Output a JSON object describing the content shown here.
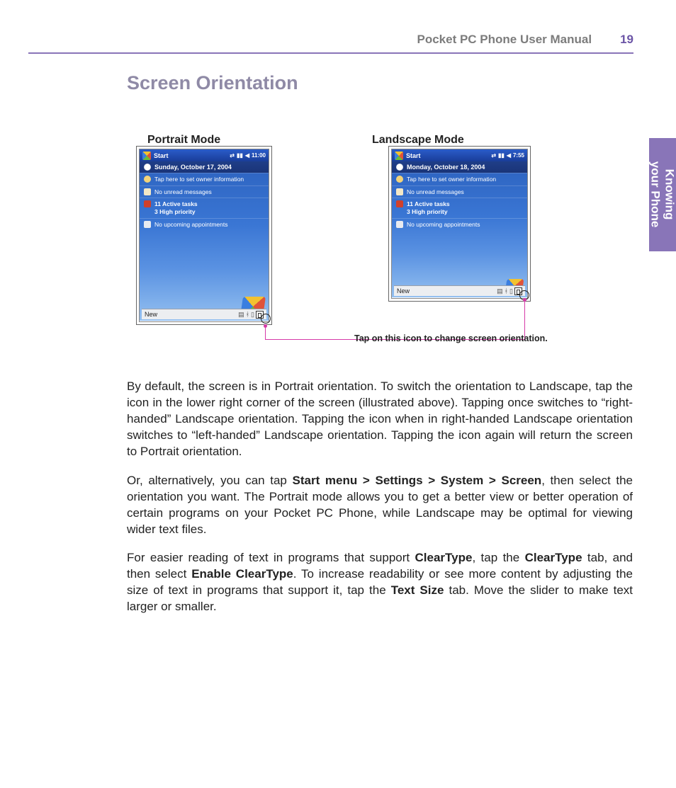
{
  "header": {
    "manual_title": "Pocket PC Phone User Manual",
    "page_number": "19"
  },
  "chapter_tab": {
    "line1": "Knowing",
    "line2": "your  Phone"
  },
  "section_title": "Screen Orientation",
  "modes": {
    "portrait_label": "Portrait Mode",
    "landscape_label": "Landscape Mode"
  },
  "portrait_screen": {
    "start": "Start",
    "clock": "11:00",
    "date": "Sunday, October 17, 2004",
    "items": [
      "Tap here to set owner information",
      "No unread messages",
      "11 Active tasks\n3 High priority",
      "No upcoming appointments"
    ],
    "newbar": "New"
  },
  "landscape_screen": {
    "start": "Start",
    "clock": "7:55",
    "date": "Monday, October 18, 2004",
    "items": [
      "Tap here to set owner information",
      "No unread messages",
      "11 Active tasks\n3 High priority",
      "No upcoming appointments"
    ],
    "newbar": "New"
  },
  "callout": "Tap on this icon to change screen orientation.",
  "paragraphs": {
    "p1a": "By default, the screen is in Portrait orientation.  To switch the orientation to Landscape, tap the icon in the lower right corner of the screen (illustrated above).  Tapping once switches to “right-handed” Landscape orientation.  Tapping the icon when in right-handed Landscape orientation switches to “left-handed” Landscape orientation.  Tapping the icon again will return the screen to Portrait orientation.",
    "p2_pre": "Or, alternatively, you can tap ",
    "p2_bold1": "Start menu > Settings > System > Screen",
    "p2_post": ", then select the orientation you want.  The Portrait mode allows you to get a better view or better opera­tion of certain programs on your Pocket PC Phone, while Landscape may be optimal for viewing wider text files.",
    "p3_pre": "For easier reading of text in programs that support ",
    "p3_b1": "ClearType",
    "p3_mid1": ", tap the ",
    "p3_b2": "ClearType",
    "p3_mid2": " tab, and then select ",
    "p3_b3": "Enable ClearType",
    "p3_mid3": ".  To increase readability or see more content by adjusting the size of text in programs that support it, tap the ",
    "p3_b4": "Text Size",
    "p3_post": " tab.  Move the slider to make text larger or smaller."
  }
}
